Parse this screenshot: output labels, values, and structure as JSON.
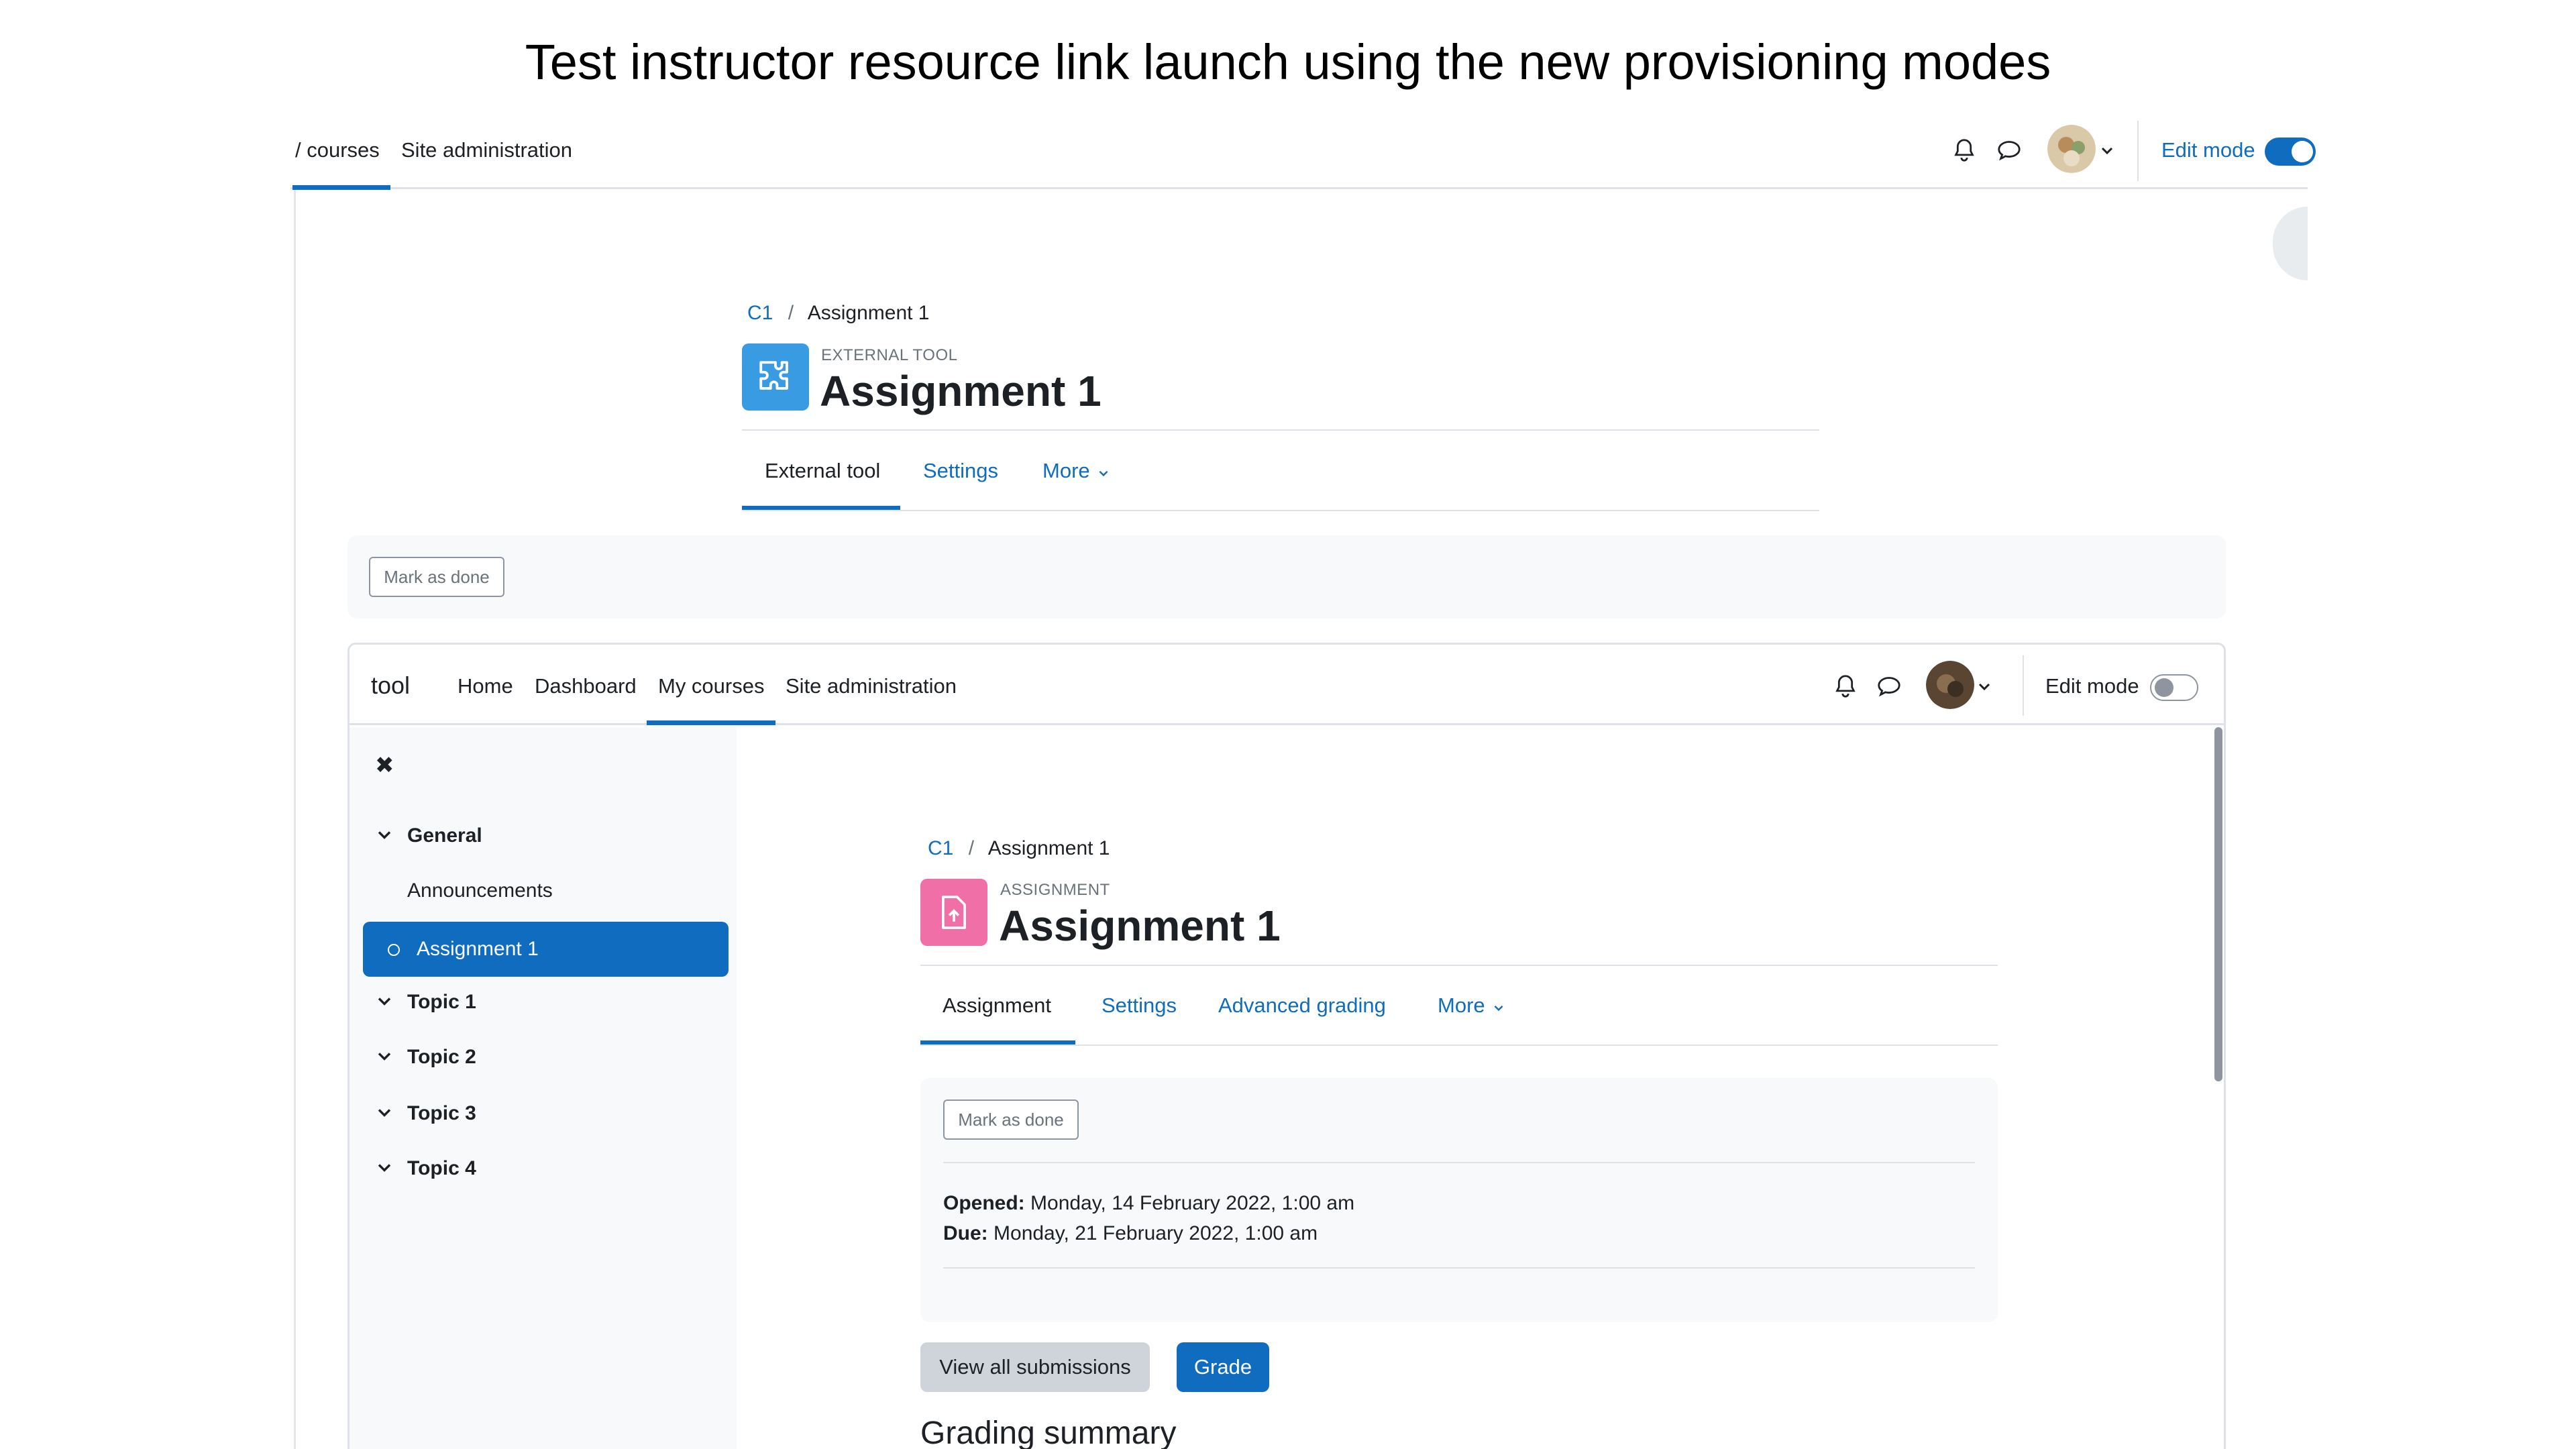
{
  "slide_title": "Test instructor resource link launch using the new provisioning modes",
  "colors": {
    "accent": "#0f6cbf",
    "external_tool_icon": "#399be2",
    "assignment_icon": "#f06fa6",
    "sidebar_bg": "#f8f9fa"
  },
  "outer": {
    "nav": {
      "my_courses": "/ courses",
      "site_admin": "Site administration"
    },
    "header_icons": [
      "bell-icon",
      "chat-icon",
      "avatar",
      "chevron-down-icon"
    ],
    "edit_mode_label": "Edit mode",
    "edit_mode_on": true,
    "breadcrumb": {
      "course": "C1",
      "separator": "/",
      "current": "Assignment 1"
    },
    "activity_type": "EXTERNAL TOOL",
    "activity_title": "Assignment 1",
    "tabs": {
      "external_tool": "External tool",
      "settings": "Settings",
      "more": "More"
    },
    "mark_done": "Mark as done"
  },
  "inner": {
    "brand": "tool",
    "nav": {
      "home": "Home",
      "dashboard": "Dashboard",
      "my_courses": "My courses",
      "site_admin": "Site administration"
    },
    "edit_mode_label": "Edit mode",
    "edit_mode_on": false,
    "sidebar": {
      "close": "✖",
      "general": "General",
      "announcements": "Announcements",
      "assignment1": "Assignment 1",
      "topic1": "Topic 1",
      "topic2": "Topic 2",
      "topic3": "Topic 3",
      "topic4": "Topic 4"
    },
    "breadcrumb": {
      "course": "C1",
      "separator": "/",
      "current": "Assignment 1"
    },
    "activity_type": "ASSIGNMENT",
    "activity_title": "Assignment 1",
    "tabs": {
      "assignment": "Assignment",
      "settings": "Settings",
      "advanced_grading": "Advanced grading",
      "more": "More"
    },
    "mark_done": "Mark as done",
    "opened_label": "Opened:",
    "opened_value": "Monday, 14 February 2022, 1:00 am",
    "due_label": "Due:",
    "due_value": "Monday, 21 February 2022, 1:00 am",
    "view_submissions": "View all submissions",
    "grade": "Grade",
    "grading_summary": "Grading summary"
  }
}
